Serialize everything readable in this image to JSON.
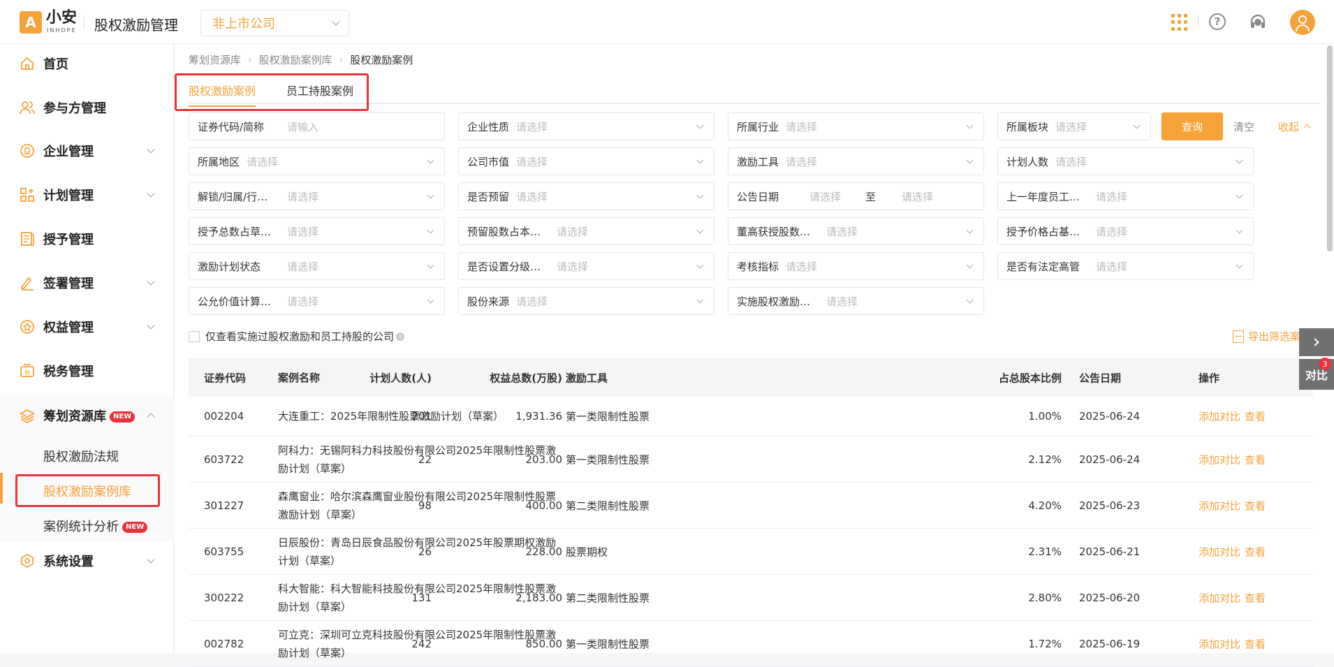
{
  "header": {
    "logo_mark": "A",
    "logo_text": "小安",
    "logo_sub": "INHOPE",
    "app_title": "股权激励管理",
    "company_type": "非上市公司",
    "help_glyph": "?",
    "colors": {
      "brand": "#f7a239",
      "danger": "#e8333a"
    }
  },
  "sidebar": {
    "items": [
      {
        "label": "首页",
        "icon": "home-icon"
      },
      {
        "label": "参与方管理",
        "icon": "users-icon"
      },
      {
        "label": "企业管理",
        "icon": "company-icon"
      },
      {
        "label": "计划管理",
        "icon": "plan-icon"
      },
      {
        "label": "授予管理",
        "icon": "grant-icon"
      },
      {
        "label": "签署管理",
        "icon": "sign-icon"
      },
      {
        "label": "权益管理",
        "icon": "equity-icon"
      },
      {
        "label": "税务管理",
        "icon": "tax-icon"
      },
      {
        "label": "筹划资源库",
        "icon": "layers-icon",
        "badge": "NEW"
      },
      {
        "label": "系统设置",
        "icon": "settings-icon"
      }
    ],
    "sub_items": [
      {
        "label": "股权激励法规"
      },
      {
        "label": "股权激励案例库"
      },
      {
        "label": "案例统计分析",
        "badge": "NEW"
      }
    ]
  },
  "breadcrumb": [
    "筹划资源库",
    "股权激励案例库",
    "股权激励案例"
  ],
  "tabs": [
    "股权激励案例",
    "员工持股案例"
  ],
  "filters": {
    "r1": [
      {
        "label": "证券代码/简称",
        "placeholder": "请输入"
      },
      {
        "label": "企业性质",
        "placeholder": "请选择"
      },
      {
        "label": "所属行业",
        "placeholder": "请选择"
      },
      {
        "label": "所属板块",
        "placeholder": "请选择"
      }
    ],
    "r2": [
      {
        "label": "所属地区",
        "placeholder": "请选择"
      },
      {
        "label": "公司市值",
        "placeholder": "请选择"
      },
      {
        "label": "激励工具",
        "placeholder": "请选择"
      },
      {
        "label": "计划人数",
        "placeholder": "请选择"
      }
    ],
    "r3": [
      {
        "label": "解锁/归属/行…",
        "placeholder": "请选择"
      },
      {
        "label": "是否预留",
        "placeholder": "请选择"
      },
      {
        "label": "公告日期",
        "placeholder": "请选择",
        "to": "至",
        "placeholder2": "请选择"
      },
      {
        "label": "上一年度员工…",
        "placeholder": "请选择"
      }
    ],
    "r4": [
      {
        "label": "授予总数占草…",
        "placeholder": "请选择"
      },
      {
        "label": "预留股数占本…",
        "placeholder": "请选择"
      },
      {
        "label": "董高获授股数…",
        "placeholder": "请选择"
      },
      {
        "label": "授予价格占基…",
        "placeholder": "请选择"
      }
    ],
    "r5": [
      {
        "label": "激励计划状态",
        "placeholder": "请选择"
      },
      {
        "label": "是否设置分级…",
        "placeholder": "请选择"
      },
      {
        "label": "考核指标",
        "placeholder": "请选择"
      },
      {
        "label": "是否有法定高管",
        "placeholder": "请选择"
      }
    ],
    "r6": [
      {
        "label": "公允价值计算…",
        "placeholder": "请选择"
      },
      {
        "label": "股份来源",
        "placeholder": "请选择"
      },
      {
        "label": "实施股权激励…",
        "placeholder": "请选择"
      }
    ]
  },
  "actions": {
    "query": "查询",
    "clear": "清空",
    "collapse": "收起"
  },
  "checkbox_label": "仅查看实施过股权激励和员工持股的公司",
  "info_glyph": "i",
  "export_label": "导出筛选案例",
  "table": {
    "headers": [
      "证券代码",
      "案例名称",
      "激励工具",
      "计划人数(人)",
      "权益总数(万股)",
      "占总股本比例",
      "公告日期",
      "操作"
    ],
    "op_labels": [
      "添加对比",
      "查看"
    ],
    "rows": [
      {
        "code": "002204",
        "name": "大连重工：2025年限制性股票激励计划（草案）",
        "tool": "第一类限制性股票",
        "count": "201",
        "equity": "1,931.36",
        "pct": "1.00%",
        "date": "2025-06-24"
      },
      {
        "code": "603722",
        "name": "阿科力：无锡阿科力科技股份有限公司2025年限制性股票激励计划（草案）",
        "tool": "第一类限制性股票",
        "count": "22",
        "equity": "203.00",
        "pct": "2.12%",
        "date": "2025-06-24"
      },
      {
        "code": "301227",
        "name": "森鹰窗业：哈尔滨森鹰窗业股份有限公司2025年限制性股票激励计划（草案）",
        "tool": "第二类限制性股票",
        "count": "98",
        "equity": "400.00",
        "pct": "4.20%",
        "date": "2025-06-23"
      },
      {
        "code": "603755",
        "name": "日辰股份：青岛日辰食品股份有限公司2025年股票期权激励计划（草案）",
        "tool": "股票期权",
        "count": "26",
        "equity": "228.00",
        "pct": "2.31%",
        "date": "2025-06-21"
      },
      {
        "code": "300222",
        "name": "科大智能：科大智能科技股份有限公司2025年限制性股票激励计划（草案）",
        "tool": "第二类限制性股票",
        "count": "131",
        "equity": "2,183.00",
        "pct": "2.80%",
        "date": "2025-06-20"
      },
      {
        "code": "002782",
        "name": "可立克：深圳可立克科技股份有限公司2025年限制性股票激励计划（草案）",
        "tool": "第一类限制性股票",
        "count": "242",
        "equity": "850.00",
        "pct": "1.72%",
        "date": "2025-06-19"
      }
    ]
  },
  "compare": {
    "label": "对比",
    "count": "3"
  }
}
